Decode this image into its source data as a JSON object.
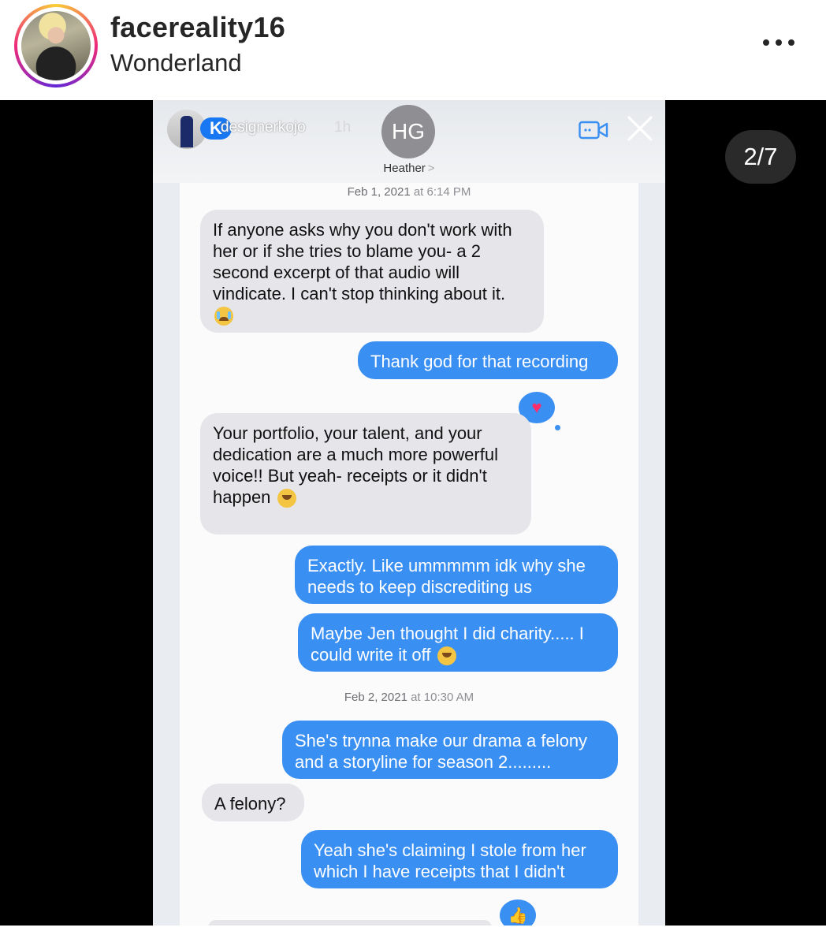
{
  "post": {
    "username": "facereality16",
    "location": "Wonderland",
    "more_icon": "more-horizontal-icon"
  },
  "story": {
    "counter": "2/7",
    "overlay": {
      "username": "designerkojo",
      "time": "1h",
      "logo_text": "K"
    },
    "contact": {
      "initials": "HG",
      "name": "Heather",
      "chevron": ">"
    },
    "messages": [
      {
        "type": "timestamp",
        "date": "Feb 1, 2021",
        "time": "at 6:14 PM"
      },
      {
        "type": "received",
        "text": "If anyone asks why you don't work with her or if she tries to blame you- a 2 second excerpt of that audio will vindicate. I can't stop thinking about it.",
        "emoji": "crying-face"
      },
      {
        "type": "sent",
        "text": "Thank god for that recording"
      },
      {
        "type": "received",
        "text": "Your portfolio, your talent,  and your dedication are a much more powerful voice!! But yeah- receipts or it didn't happen",
        "emoji": "laughing-face",
        "tapback": "heart"
      },
      {
        "type": "sent",
        "text": "Exactly. Like ummmmm idk why she needs to keep discrediting us"
      },
      {
        "type": "sent",
        "text": "Maybe Jen thought I did charity..... I could write it off",
        "emoji": "laughing-face"
      },
      {
        "type": "timestamp",
        "date": "Feb 2, 2021",
        "time": "at 10:30 AM"
      },
      {
        "type": "sent",
        "text": "She's trynna make our drama a felony and a storyline for season 2........."
      },
      {
        "type": "received",
        "text": "A felony?"
      },
      {
        "type": "sent",
        "text": "Yeah she's claiming I stole from her which I have receipts that I didn't",
        "tapback": "thumbs-up"
      }
    ]
  },
  "colors": {
    "imessage_blue": "#3a8ff2",
    "received_gray": "#e5e5ea",
    "ig_black": "#262626"
  }
}
